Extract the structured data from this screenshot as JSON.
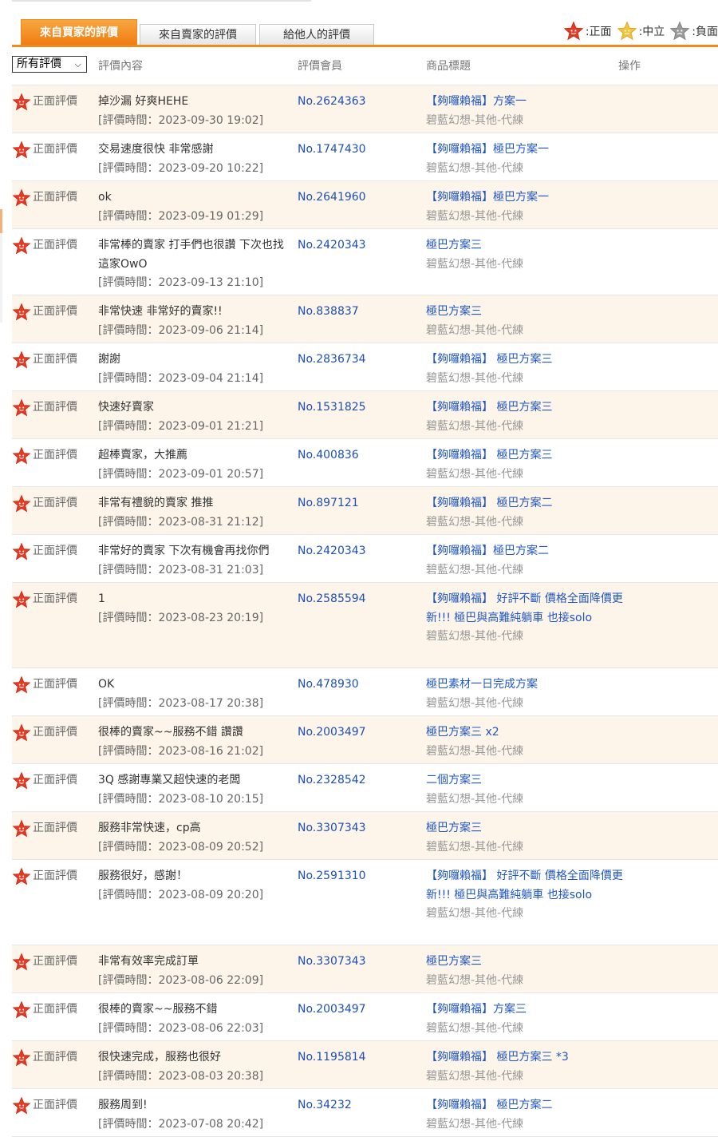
{
  "tabs": [
    {
      "label": "來自買家的評價",
      "active": true
    },
    {
      "label": "來自賣家的評價",
      "active": false
    },
    {
      "label": "給他人的評價",
      "active": false
    }
  ],
  "legend": {
    "positive": ":正面",
    "neutral": ":中立",
    "negative": ":負面"
  },
  "colors": {
    "accent": "#f08a1c",
    "link": "#2056c4",
    "row_alt_bg": "#fdf5e9",
    "positive_icon": "#e53b25",
    "neutral_icon": "#f3c33a",
    "negative_icon": "#9a9a9a"
  },
  "table": {
    "filter": "所有評價",
    "headers": {
      "content": "評價內容",
      "member": "評價會員",
      "product": "商品標題",
      "action": "操作"
    },
    "rows": [
      {
        "type": "正面評價",
        "content": "掉沙漏 好爽HEHE",
        "time": "[評價時間：2023-09-30 19:02]",
        "member": "No.2624363",
        "product": "【夠囉賴福】方案一",
        "category": "碧藍幻想-其他-代練"
      },
      {
        "type": "正面評價",
        "content": "交易速度很快 非常感謝",
        "time": "[評價時間：2023-09-20 10:22]",
        "member": "No.1747430",
        "product": "【夠囉賴福】極巴方案一",
        "category": "碧藍幻想-其他-代練"
      },
      {
        "type": "正面評價",
        "content": "ok",
        "time": "[評價時間：2023-09-19 01:29]",
        "member": "No.2641960",
        "product": "【夠囉賴福】極巴方案一",
        "category": "碧藍幻想-其他-代練"
      },
      {
        "type": "正面評價",
        "content": "非常棒的賣家 打手們也很讚 下次也找這家OwO",
        "time": "[評價時間：2023-09-13 21:10]",
        "member": "No.2420343",
        "product": "極巴方案三",
        "category": "碧藍幻想-其他-代練"
      },
      {
        "type": "正面評價",
        "content": "非常快速 非常好的賣家!!",
        "time": "[評價時間：2023-09-06 21:14]",
        "member": "No.838837",
        "product": "極巴方案三",
        "category": "碧藍幻想-其他-代練"
      },
      {
        "type": "正面評價",
        "content": "謝謝",
        "time": "[評價時間：2023-09-04 21:14]",
        "member": "No.2836734",
        "product": "【夠囉賴福】 極巴方案三",
        "category": "碧藍幻想-其他-代練"
      },
      {
        "type": "正面評價",
        "content": "快速好賣家",
        "time": "[評價時間：2023-09-01 21:21]",
        "member": "No.1531825",
        "product": "【夠囉賴福】 極巴方案三",
        "category": "碧藍幻想-其他-代練"
      },
      {
        "type": "正面評價",
        "content": "超棒賣家，大推薦",
        "time": "[評價時間：2023-09-01 20:57]",
        "member": "No.400836",
        "product": "【夠囉賴福】 極巴方案三",
        "category": "碧藍幻想-其他-代練"
      },
      {
        "type": "正面評價",
        "content": "非常有禮貌的賣家 推推",
        "time": "[評價時間：2023-08-31 21:12]",
        "member": "No.897121",
        "product": "【夠囉賴福】 極巴方案二",
        "category": "碧藍幻想-其他-代練"
      },
      {
        "type": "正面評價",
        "content": "非常好的賣家 下次有機會再找你們",
        "time": "[評價時間：2023-08-31 21:03]",
        "member": "No.2420343",
        "product": "【夠囉賴福】極巴方案二",
        "category": "碧藍幻想-其他-代練"
      },
      {
        "type": "正面評價",
        "content": "1",
        "time": "[評價時間：2023-08-23 20:19]",
        "member": "No.2585594",
        "product": "【夠囉賴福】 好評不斷 價格全面降價更新!!! 極巴與高難純躺車 也接solo",
        "category": "碧藍幻想-其他-代練"
      },
      {
        "type": "正面評價",
        "content": "OK",
        "time": "[評價時間：2023-08-17 20:38]",
        "member": "No.478930",
        "product": "極巴素材一日完成方案",
        "category": "碧藍幻想-其他-代練"
      },
      {
        "type": "正面評價",
        "content": "很棒的賣家~~服務不錯 讚讚",
        "time": "[評價時間：2023-08-16 21:02]",
        "member": "No.2003497",
        "product": "極巴方案三 x2",
        "category": "碧藍幻想-其他-代練"
      },
      {
        "type": "正面評價",
        "content": "3Q 感謝專業又超快速的老闆",
        "time": "[評價時間：2023-08-10 20:15]",
        "member": "No.2328542",
        "product": "二個方案三",
        "category": "碧藍幻想-其他-代練"
      },
      {
        "type": "正面評價",
        "content": "服務非常快速，cp高",
        "time": "[評價時間：2023-08-09 20:52]",
        "member": "No.3307343",
        "product": "極巴方案三",
        "category": "碧藍幻想-其他-代練"
      },
      {
        "type": "正面評價",
        "content": "服務很好，感謝！",
        "time": "[評價時間：2023-08-09 20:20]",
        "member": "No.2591310",
        "product": "【夠囉賴福】 好評不斷 價格全面降價更新!!! 極巴與高難純躺車 也接solo",
        "category": "碧藍幻想-其他-代練"
      },
      {
        "type": "正面評價",
        "content": "非常有效率完成訂單",
        "time": "[評價時間：2023-08-06 22:09]",
        "member": "No.3307343",
        "product": "極巴方案三",
        "category": "碧藍幻想-其他-代練"
      },
      {
        "type": "正面評價",
        "content": "很棒的賣家~~服務不錯",
        "time": "[評價時間：2023-08-06 22:03]",
        "member": "No.2003497",
        "product": "【夠囉賴福】方案三",
        "category": "碧藍幻想-其他-代練"
      },
      {
        "type": "正面評價",
        "content": "很快速完成，服務也很好",
        "time": "[評價時間：2023-08-03 20:38]",
        "member": "No.1195814",
        "product": "【夠囉賴福】 極巴方案三 *3",
        "category": "碧藍幻想-其他-代練"
      },
      {
        "type": "正面評價",
        "content": "服務周到!",
        "time": "[評價時間：2023-07-08 20:42]",
        "member": "No.34232",
        "product": "【夠囉賴福】 極巴方案二",
        "category": "碧藍幻想-其他-代練"
      }
    ]
  }
}
